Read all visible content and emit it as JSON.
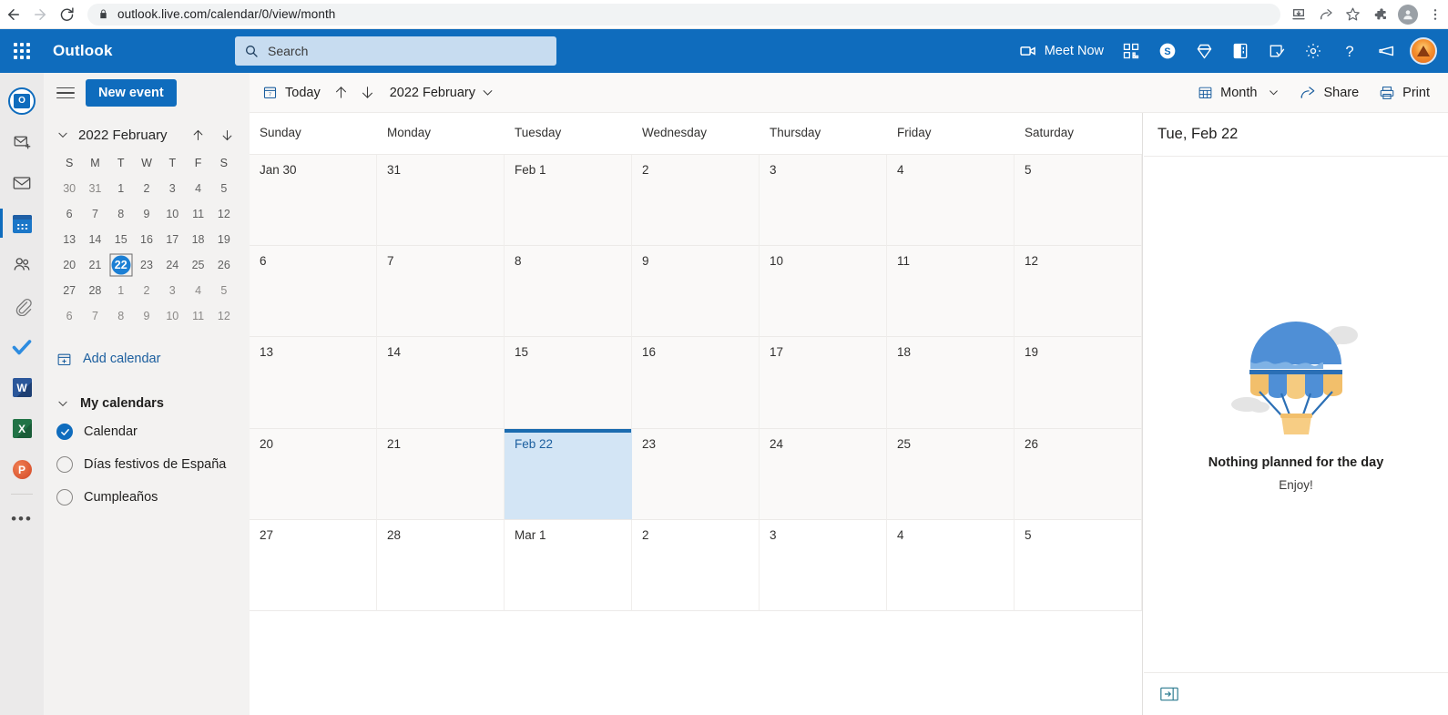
{
  "browser": {
    "back_label": "Back",
    "forward_label": "Forward",
    "reload_label": "Reload",
    "url_secure": "outlook.live.com",
    "url_path": "/calendar/0/view/month",
    "url_full": "outlook.live.com/calendar/0/view/month",
    "icons": [
      "download-icon",
      "share-icon",
      "bookmark-star-icon",
      "extensions-puzzle-icon",
      "profile-avatar-icon",
      "browser-menu-icon"
    ]
  },
  "suite_header": {
    "waffle_label": "App launcher",
    "brand": "Outlook",
    "search_placeholder": "Search",
    "search_value": "",
    "meet_now_label": "Meet Now",
    "right_icons": [
      "qr-code-icon",
      "skype-icon",
      "diamond-premium-icon",
      "onenote-icon",
      "to-do-icon",
      "settings-gear-icon",
      "help-question-icon",
      "feedback-megaphone-icon"
    ],
    "account_label": "Account manager"
  },
  "app_rail": {
    "items": [
      {
        "name": "outlook-logo",
        "label": "Outlook"
      },
      {
        "name": "new-mail-icon",
        "label": "New mail"
      },
      {
        "name": "mail-icon",
        "label": "Mail"
      },
      {
        "name": "calendar-icon",
        "label": "Calendar",
        "selected": true
      },
      {
        "name": "people-icon",
        "label": "People"
      },
      {
        "name": "files-paperclip-icon",
        "label": "Files"
      },
      {
        "name": "to-do-check-icon",
        "label": "To Do"
      },
      {
        "name": "word-icon",
        "label": "Word",
        "glyph": "W"
      },
      {
        "name": "excel-icon",
        "label": "Excel",
        "glyph": "X"
      },
      {
        "name": "powerpoint-icon",
        "label": "PowerPoint",
        "glyph": "P"
      },
      {
        "name": "more-apps-icon",
        "label": "More apps"
      }
    ]
  },
  "left_panel": {
    "menu_label": "Toggle navigation",
    "new_event_label": "New event",
    "mini_calendar": {
      "title": "2022 February",
      "collapse_label": "Collapse",
      "prev_label": "Previous month",
      "next_label": "Next month",
      "day_initials": [
        "S",
        "M",
        "T",
        "W",
        "T",
        "F",
        "S"
      ],
      "weeks": [
        [
          {
            "d": "30",
            "out": true
          },
          {
            "d": "31",
            "out": true
          },
          {
            "d": "1"
          },
          {
            "d": "2"
          },
          {
            "d": "3"
          },
          {
            "d": "4"
          },
          {
            "d": "5"
          }
        ],
        [
          {
            "d": "6"
          },
          {
            "d": "7"
          },
          {
            "d": "8"
          },
          {
            "d": "9"
          },
          {
            "d": "10"
          },
          {
            "d": "11"
          },
          {
            "d": "12"
          }
        ],
        [
          {
            "d": "13"
          },
          {
            "d": "14"
          },
          {
            "d": "15"
          },
          {
            "d": "16"
          },
          {
            "d": "17"
          },
          {
            "d": "18"
          },
          {
            "d": "19"
          }
        ],
        [
          {
            "d": "20"
          },
          {
            "d": "21"
          },
          {
            "d": "22",
            "selected": true
          },
          {
            "d": "23"
          },
          {
            "d": "24"
          },
          {
            "d": "25"
          },
          {
            "d": "26"
          }
        ],
        [
          {
            "d": "27"
          },
          {
            "d": "28"
          },
          {
            "d": "1",
            "out": true
          },
          {
            "d": "2",
            "out": true
          },
          {
            "d": "3",
            "out": true
          },
          {
            "d": "4",
            "out": true
          },
          {
            "d": "5",
            "out": true
          }
        ],
        [
          {
            "d": "6",
            "out": true
          },
          {
            "d": "7",
            "out": true
          },
          {
            "d": "8",
            "out": true
          },
          {
            "d": "9",
            "out": true
          },
          {
            "d": "10",
            "out": true
          },
          {
            "d": "11",
            "out": true
          },
          {
            "d": "12",
            "out": true
          }
        ]
      ]
    },
    "add_calendar_label": "Add calendar",
    "my_calendars_label": "My calendars",
    "calendars": [
      {
        "label": "Calendar",
        "checked": true
      },
      {
        "label": "Días festivos de España",
        "checked": false
      },
      {
        "label": "Cumpleaños",
        "checked": false
      }
    ]
  },
  "toolbar": {
    "today_label": "Today",
    "prev_label": "Previous",
    "next_label": "Next",
    "period_label": "2022 February",
    "period_dropdown_label": "Change period",
    "view_label": "Month",
    "share_label": "Share",
    "print_label": "Print"
  },
  "month_view": {
    "day_headers": [
      "Sunday",
      "Monday",
      "Tuesday",
      "Wednesday",
      "Thursday",
      "Friday",
      "Saturday"
    ],
    "weeks": [
      [
        {
          "label": "Jan 30"
        },
        {
          "label": "31"
        },
        {
          "label": "Feb 1"
        },
        {
          "label": "2"
        },
        {
          "label": "3"
        },
        {
          "label": "4"
        },
        {
          "label": "5"
        }
      ],
      [
        {
          "label": "6"
        },
        {
          "label": "7"
        },
        {
          "label": "8"
        },
        {
          "label": "9"
        },
        {
          "label": "10"
        },
        {
          "label": "11"
        },
        {
          "label": "12"
        }
      ],
      [
        {
          "label": "13"
        },
        {
          "label": "14"
        },
        {
          "label": "15"
        },
        {
          "label": "16"
        },
        {
          "label": "17"
        },
        {
          "label": "18"
        },
        {
          "label": "19"
        }
      ],
      [
        {
          "label": "20"
        },
        {
          "label": "21"
        },
        {
          "label": "Feb 22",
          "selected": true
        },
        {
          "label": "23"
        },
        {
          "label": "24"
        },
        {
          "label": "25"
        },
        {
          "label": "26"
        }
      ],
      [
        {
          "label": "27"
        },
        {
          "label": "28"
        },
        {
          "label": "Mar 1"
        },
        {
          "label": "2"
        },
        {
          "label": "3"
        },
        {
          "label": "4"
        },
        {
          "label": "5"
        }
      ]
    ]
  },
  "agenda": {
    "selected_date": "Tue, Feb 22",
    "empty_title": "Nothing planned for the day",
    "empty_subtitle": "Enjoy!",
    "collapse_pane_label": "Collapse pane"
  },
  "colors": {
    "brand_blue": "#0f6cbd",
    "selected_cell": "#d3e5f5",
    "selected_border": "#1b6cb0",
    "link_blue": "#1b5e9e",
    "panel_bg": "#f3f2f1",
    "cell_bg": "#faf9f8"
  }
}
